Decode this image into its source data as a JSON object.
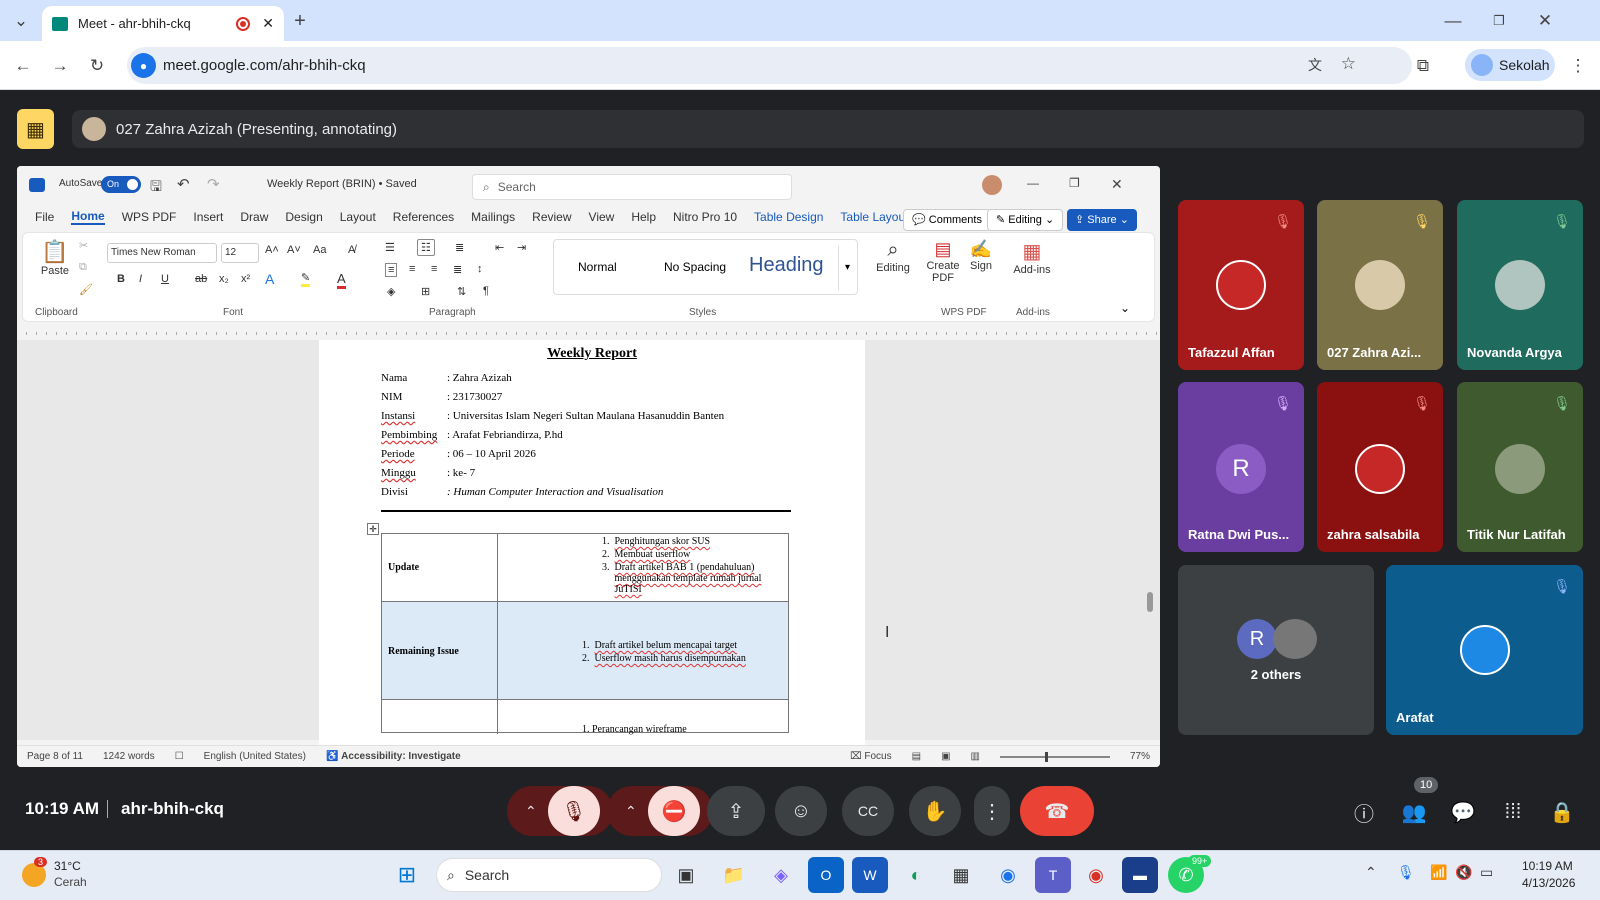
{
  "browser": {
    "tab_title": "Meet - ahr-bhih-ckq",
    "url": "meet.google.com/ahr-bhih-ckq",
    "profile_name": "Sekolah"
  },
  "presenter": {
    "label": "027 Zahra Azizah (Presenting, annotating)"
  },
  "word": {
    "autosave": "AutoSave",
    "autosave_state": "On",
    "doc_title": "Weekly Report (BRIN) • Saved",
    "search_placeholder": "Search",
    "tabs": [
      "File",
      "Home",
      "WPS PDF",
      "Insert",
      "Draw",
      "Design",
      "Layout",
      "References",
      "Mailings",
      "Review",
      "View",
      "Help",
      "Nitro Pro 10",
      "Table Design",
      "Table Layout"
    ],
    "comments": "Comments",
    "editing": "Editing",
    "share": "Share",
    "font": "Times New Roman",
    "size": "12",
    "styles": {
      "normal": "Normal",
      "no_spacing": "No Spacing",
      "heading": "Heading"
    },
    "groups": {
      "clipboard": "Clipboard",
      "font": "Font",
      "paragraph": "Paragraph",
      "styles": "Styles",
      "wps": "WPS PDF",
      "addins": "Add-ins"
    },
    "buttons": {
      "paste": "Paste",
      "editing": "Editing",
      "create_pdf": "Create PDF",
      "sign": "Sign",
      "addins": "Add-ins"
    },
    "status": {
      "page": "Page 8 of 11",
      "words": "1242 words",
      "lang": "English (United States)",
      "access": "Accessibility: Investigate",
      "focus": "Focus",
      "zoom": "77%"
    }
  },
  "doc": {
    "title": "Weekly Report",
    "fields": [
      {
        "k": "Nama",
        "v": ": Zahra Azizah"
      },
      {
        "k": "NIM",
        "v": ": 231730027"
      },
      {
        "k": "Instansi",
        "v": ": Universitas Islam Negeri Sultan Maulana Hasanuddin Banten"
      },
      {
        "k": "Pembimbing",
        "v": ": Arafat Febriandirza, P.hd"
      },
      {
        "k": "Periode",
        "v": ": 06 – 10 April 2026"
      },
      {
        "k": "Minggu",
        "v": ": ke- 7"
      },
      {
        "k": "Divisi",
        "v": ": Human Computer Interaction and Visualisation"
      }
    ],
    "update_label": "Update",
    "update_items": [
      "Penghitungan skor SUS",
      "Membuat userflow",
      "Draft artikel BAB 1 (pendahuluan) menggunakan template rumah jurnal JuTISI"
    ],
    "issue_label": "Remaining Issue",
    "issue_items": [
      "Draft artikel belum mencapai target",
      "Userflow masih harus disempurnakan"
    ],
    "next_partial": "1.   Perancangan wireframe"
  },
  "participants": [
    {
      "name": "Tafazzul Affan",
      "muted": true
    },
    {
      "name": "027 Zahra Azi...",
      "muted": true
    },
    {
      "name": "Novanda Argya",
      "muted": true
    },
    {
      "name": "Ratna Dwi Pus...",
      "initial": "R",
      "muted": true
    },
    {
      "name": "zahra salsabila",
      "muted": true
    },
    {
      "name": "Titik Nur Latifah",
      "muted": true
    },
    {
      "name": "2 others",
      "initial": "R"
    },
    {
      "name": "Arafat",
      "muted": true
    }
  ],
  "meeting": {
    "time": "10:19 AM",
    "code": "ahr-bhih-ckq",
    "people_count": "10"
  },
  "taskbar": {
    "temp": "31°C",
    "weather": "Cerah",
    "weather_badge": "3",
    "search": "Search",
    "whatsapp_badge": "99+",
    "clock_time": "10:19 AM",
    "clock_date": "4/13/2026"
  }
}
